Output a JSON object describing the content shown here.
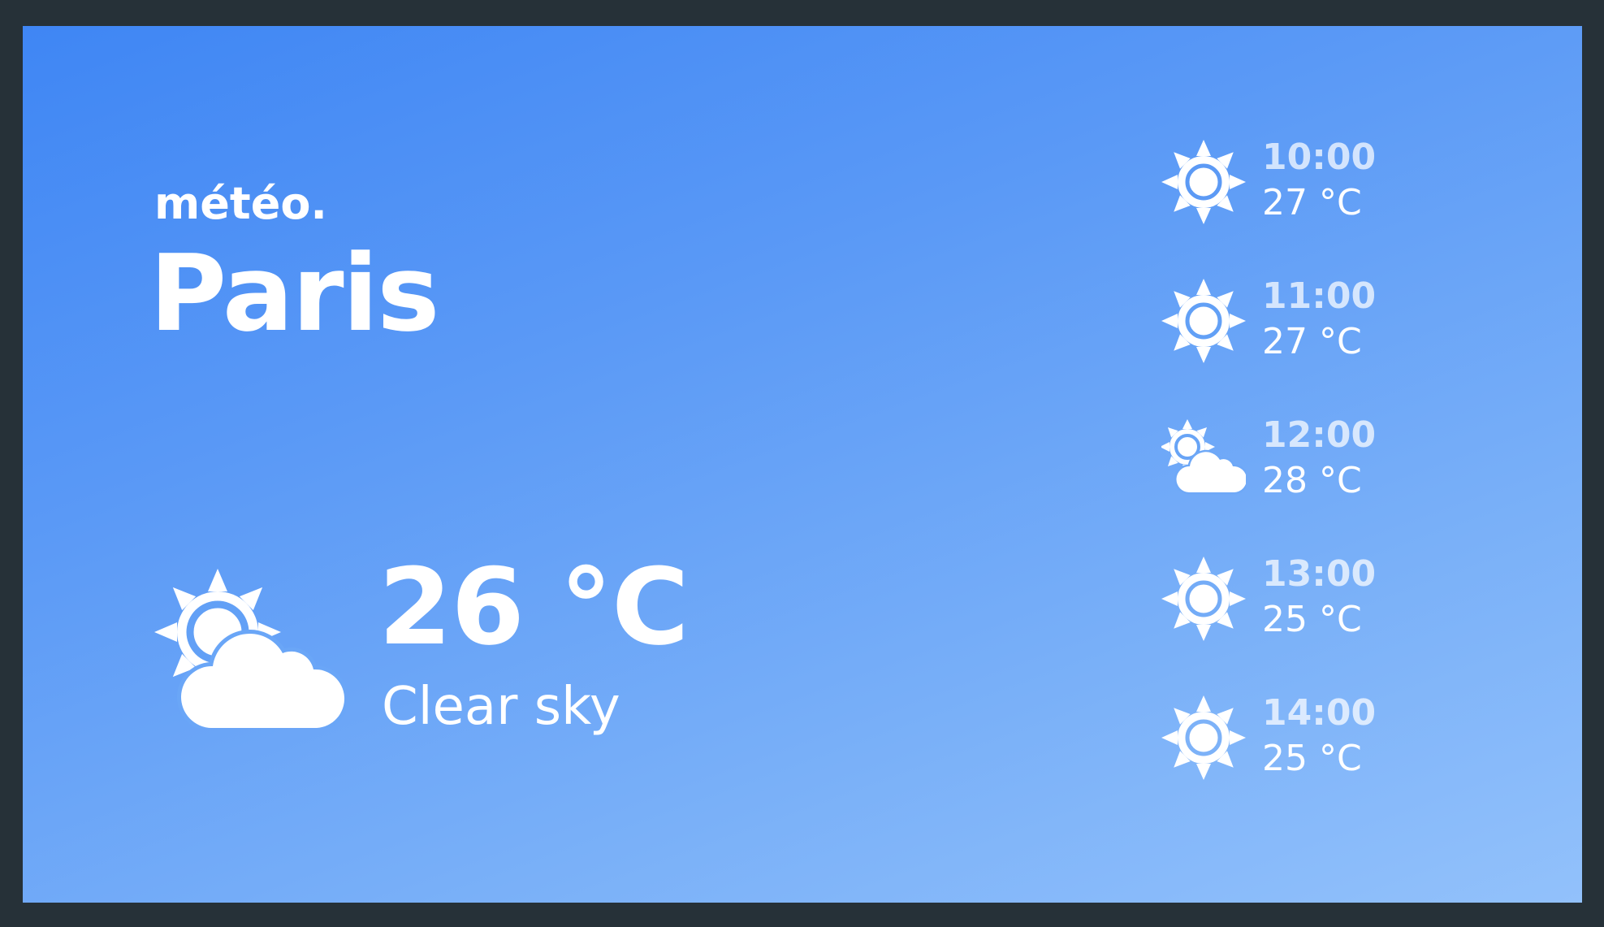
{
  "app": {
    "brand": "météo.",
    "city": "Paris"
  },
  "current": {
    "temperature": "26 °C",
    "condition": "Clear sky",
    "icon": "partly-cloudy-icon"
  },
  "forecast": [
    {
      "time": "10:00",
      "temperature": "27 °C",
      "icon": "sun-icon"
    },
    {
      "time": "11:00",
      "temperature": "27 °C",
      "icon": "sun-icon"
    },
    {
      "time": "12:00",
      "temperature": "28 °C",
      "icon": "partly-cloudy-icon"
    },
    {
      "time": "13:00",
      "temperature": "25 °C",
      "icon": "sun-icon"
    },
    {
      "time": "14:00",
      "temperature": "25 °C",
      "icon": "sun-icon"
    }
  ],
  "colors": {
    "frame": "#263138",
    "gradient_start": "#3f86f4",
    "gradient_end": "#92c1fb",
    "text": "#ffffff"
  }
}
